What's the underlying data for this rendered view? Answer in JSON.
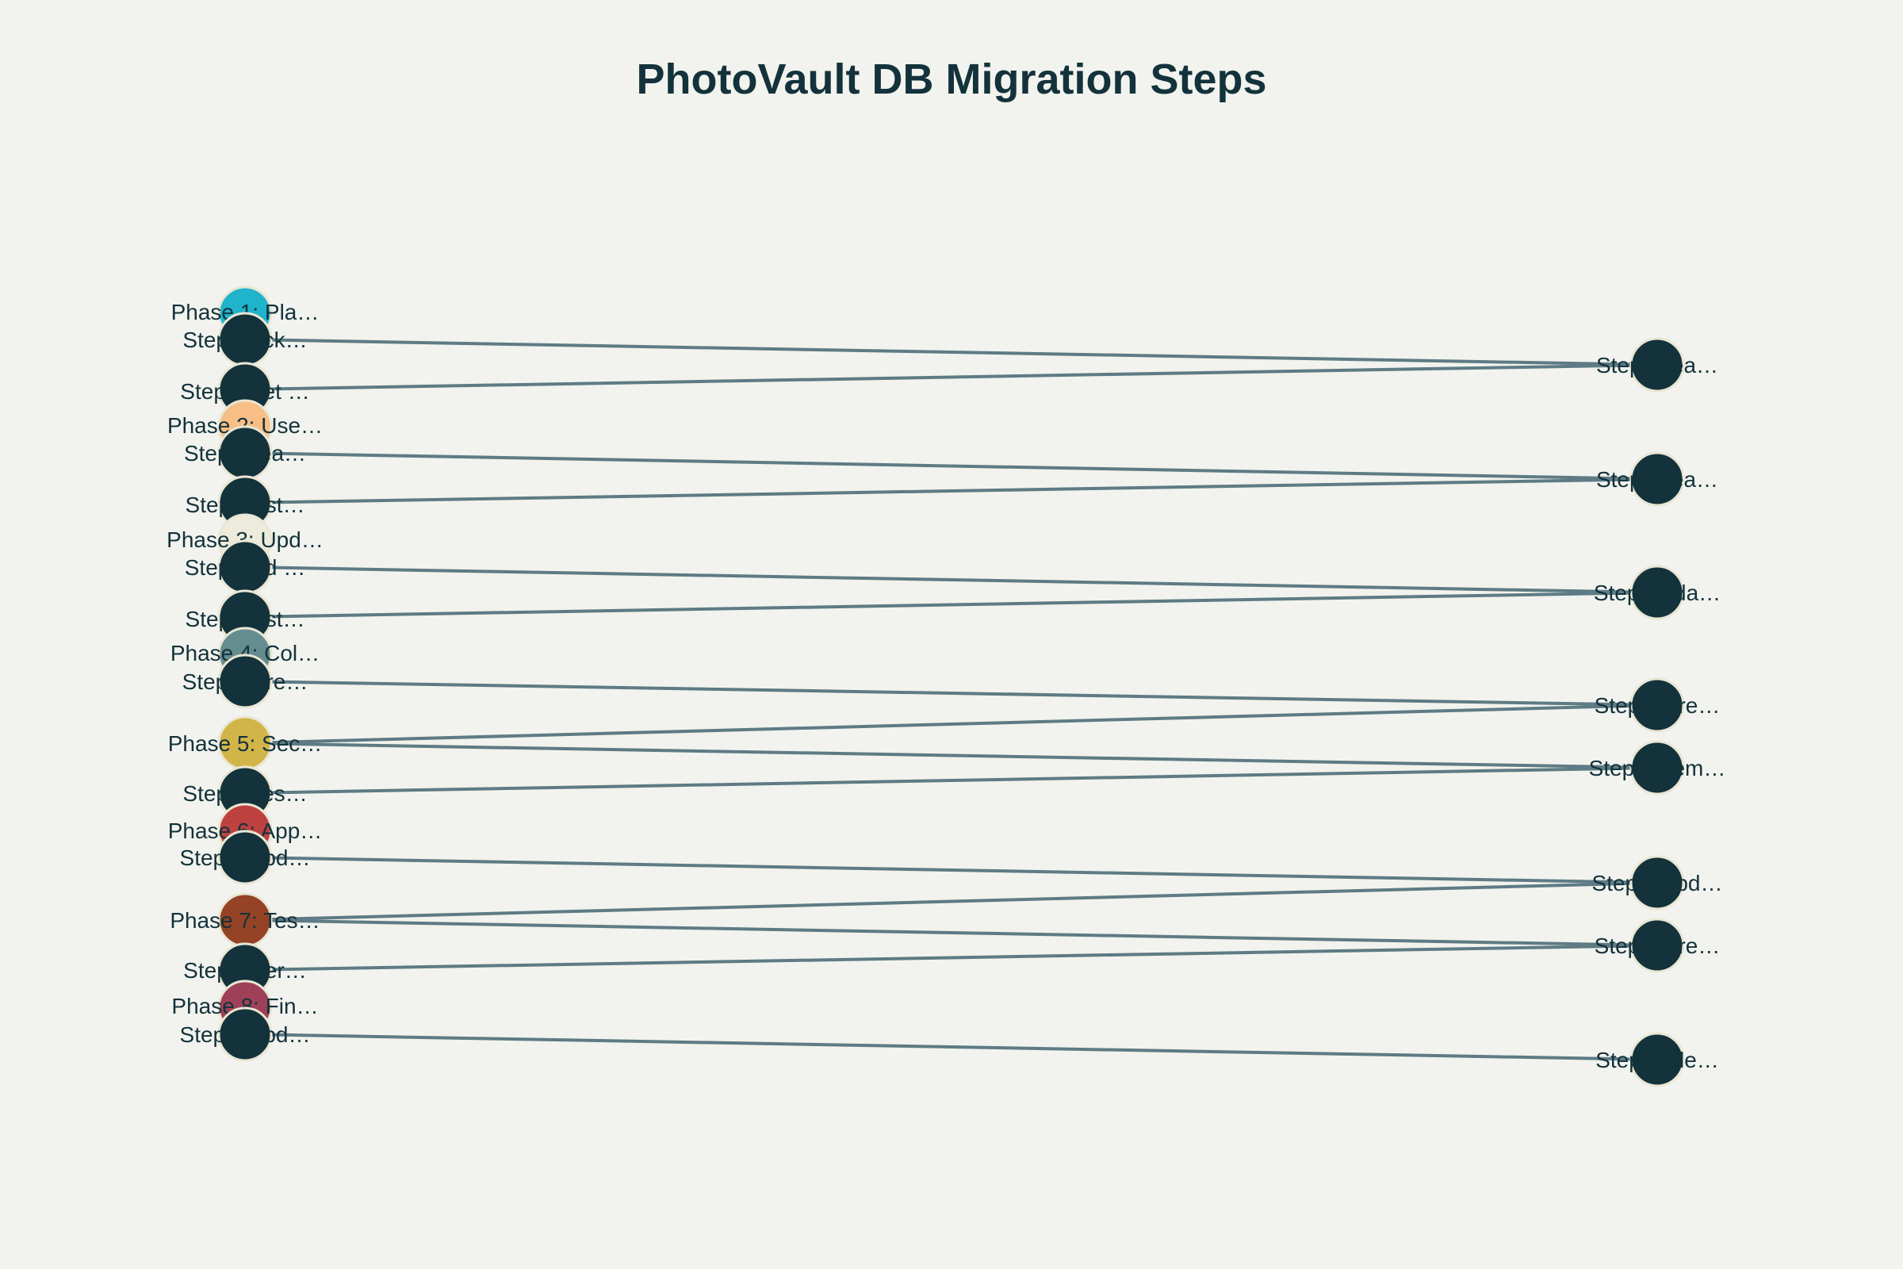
{
  "title": "PhotoVault DB Migration Steps",
  "colors": {
    "background": "#f2f3ee",
    "text": "#13323b",
    "edge": "#5e7b85",
    "step_node": "#13323b",
    "node_outline": "#e9e6d4"
  },
  "nodes": [
    {
      "id": "p1",
      "label": "Phase 1: Pla…",
      "color": "#1fb3cc"
    },
    {
      "id": "l1",
      "label": "Step…ack…",
      "color": "#13323b"
    },
    {
      "id": "l2",
      "label": "Step…Set …",
      "color": "#13323b"
    },
    {
      "id": "p2",
      "label": "Phase 2: Use…",
      "color": "#f7bf86"
    },
    {
      "id": "l3",
      "label": "Step…rea…",
      "color": "#13323b"
    },
    {
      "id": "l4",
      "label": "Step…est…",
      "color": "#13323b"
    },
    {
      "id": "p3",
      "label": "Phase 3: Upd…",
      "color": "#ecebdc"
    },
    {
      "id": "l5",
      "label": "Step…dd …",
      "color": "#13323b"
    },
    {
      "id": "l6",
      "label": "Step…est…",
      "color": "#13323b"
    },
    {
      "id": "p4",
      "label": "Phase 4: Col…",
      "color": "#658c8f"
    },
    {
      "id": "l7",
      "label": "Step…Cre…",
      "color": "#13323b"
    },
    {
      "id": "p5",
      "label": "Phase 5: Sec…",
      "color": "#d2b548"
    },
    {
      "id": "l8",
      "label": "Step…Tes…",
      "color": "#13323b"
    },
    {
      "id": "p6",
      "label": "Phase 6: App…",
      "color": "#bd423f"
    },
    {
      "id": "l9",
      "label": "Step…Upd…",
      "color": "#13323b"
    },
    {
      "id": "p7",
      "label": "Phase 7: Tes…",
      "color": "#944325"
    },
    {
      "id": "l10",
      "label": "Step…Ver…",
      "color": "#13323b"
    },
    {
      "id": "p8",
      "label": "Phase 8: Fin…",
      "color": "#9e4158"
    },
    {
      "id": "l11",
      "label": "Step…Upd…",
      "color": "#13323b"
    },
    {
      "id": "r1",
      "label": "Step…rea…",
      "color": "#13323b"
    },
    {
      "id": "r2",
      "label": "Step…rea…",
      "color": "#13323b"
    },
    {
      "id": "r3",
      "label": "Step…pda…",
      "color": "#13323b"
    },
    {
      "id": "r4",
      "label": "Step…Cre…",
      "color": "#13323b"
    },
    {
      "id": "r5",
      "label": "Step…Rem…",
      "color": "#13323b"
    },
    {
      "id": "r6",
      "label": "Step…Upd…",
      "color": "#13323b"
    },
    {
      "id": "r7",
      "label": "Step…Cre…",
      "color": "#13323b"
    },
    {
      "id": "r8",
      "label": "Step…Cle…",
      "color": "#13323b"
    }
  ],
  "edges": [
    [
      "l1",
      "r1"
    ],
    [
      "l2",
      "r1"
    ],
    [
      "l3",
      "r2"
    ],
    [
      "l4",
      "r2"
    ],
    [
      "l5",
      "r3"
    ],
    [
      "l6",
      "r3"
    ],
    [
      "l7",
      "r4"
    ],
    [
      "p5",
      "r4"
    ],
    [
      "p5",
      "r5"
    ],
    [
      "l8",
      "r5"
    ],
    [
      "l9",
      "r6"
    ],
    [
      "p7",
      "r6"
    ],
    [
      "p7",
      "r7"
    ],
    [
      "l10",
      "r7"
    ],
    [
      "l11",
      "r8"
    ]
  ]
}
